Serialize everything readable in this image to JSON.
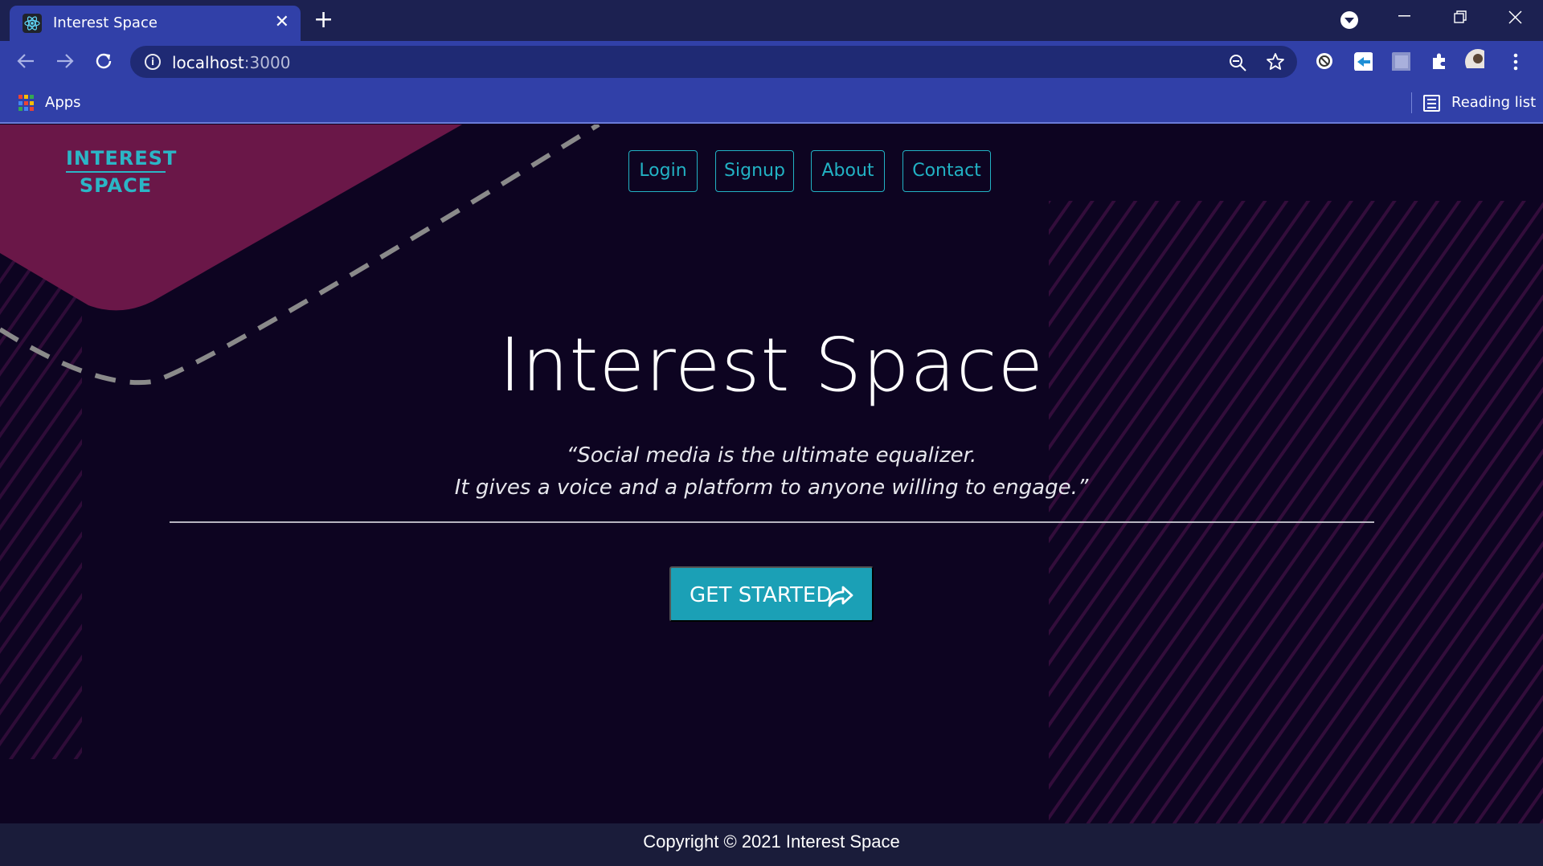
{
  "browser": {
    "tab_title": "Interest Space",
    "tab_close": "✕",
    "new_tab": "+",
    "url_host": "localhost",
    "url_port": ":3000",
    "bookmarks": {
      "apps_label": "Apps",
      "reading_list_label": "Reading list"
    },
    "icons": [
      "react-favicon-icon",
      "tab-search-icon",
      "minimize-icon",
      "restore-icon",
      "close-window-icon",
      "back-icon",
      "forward-icon",
      "reload-icon",
      "info-icon",
      "zoom-out-icon",
      "bookmark-star-icon",
      "extension-icon",
      "puzzle-icon",
      "profile-avatar",
      "kebab-menu-icon",
      "apps-grid-icon",
      "reading-list-icon"
    ]
  },
  "site": {
    "logo_line1": "INTEREST",
    "logo_line2": "SPACE",
    "nav": [
      "Login",
      "Signup",
      "About",
      "Contact"
    ],
    "hero_title": "Interest Space",
    "quote_line1": "“Social media is the ultimate equalizer.",
    "quote_line2": "It gives a voice and a platform to anyone willing to engage.”",
    "cta_label": "GET STARTED",
    "footer": "Copyright © 2021 Interest Space"
  },
  "colors": {
    "page_bg": "#0d0421",
    "accent": "#1ba0b6",
    "magenta": "#6a1748",
    "chrome": "#3140a8",
    "tabstrip": "#1c2151"
  }
}
